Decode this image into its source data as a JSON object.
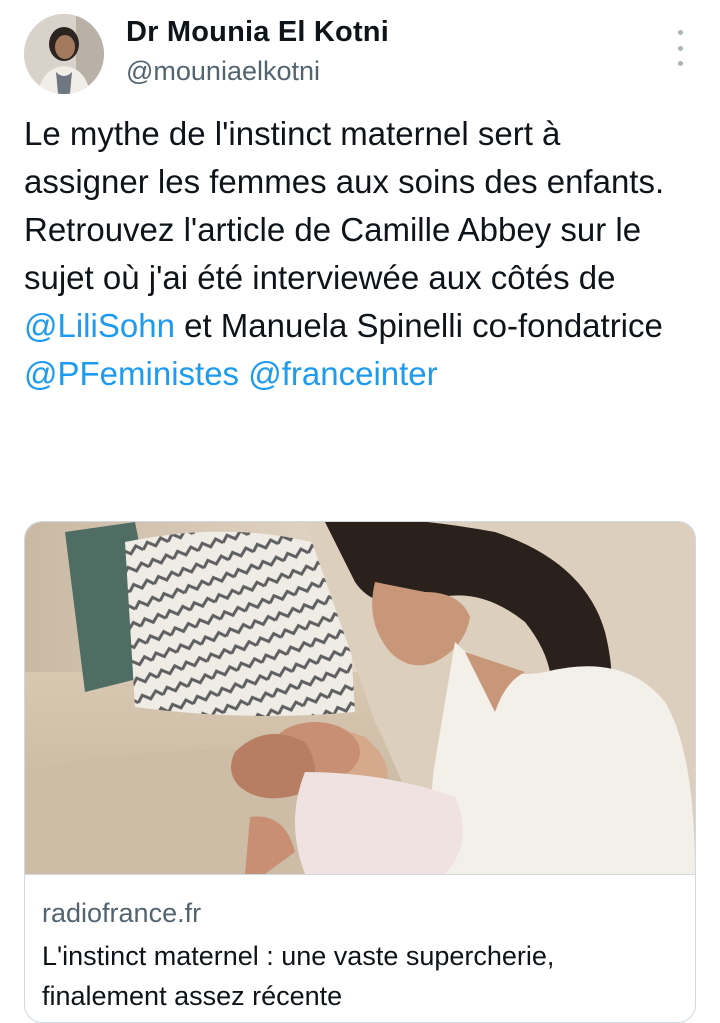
{
  "author": {
    "display_name": "Dr Mounia El Kotni",
    "handle": "@mouniaelkotni"
  },
  "tweet": {
    "line1": "Le mythe de l'instinct maternel sert à assigner les femmes aux soins des enfants.",
    "line2_prefix": "Retrouvez l'article de Camille Abbey sur le sujet où j'ai été interviewée aux côtés de ",
    "mention1": "@LiliSohn",
    "line2_mid": " et Manuela Spinelli co-fondatrice ",
    "mention2": "@PFeministes",
    "line2_space": " ",
    "mention3": "@franceinter"
  },
  "link_card": {
    "domain": "radiofrance.fr",
    "title": "L'instinct maternel : une vaste supercherie, finalement assez récente"
  },
  "colors": {
    "link": "#1d9bf0",
    "secondary_text": "#536471",
    "border": "#cfd9de"
  },
  "icons": {
    "more": "more-vertical-icon"
  }
}
